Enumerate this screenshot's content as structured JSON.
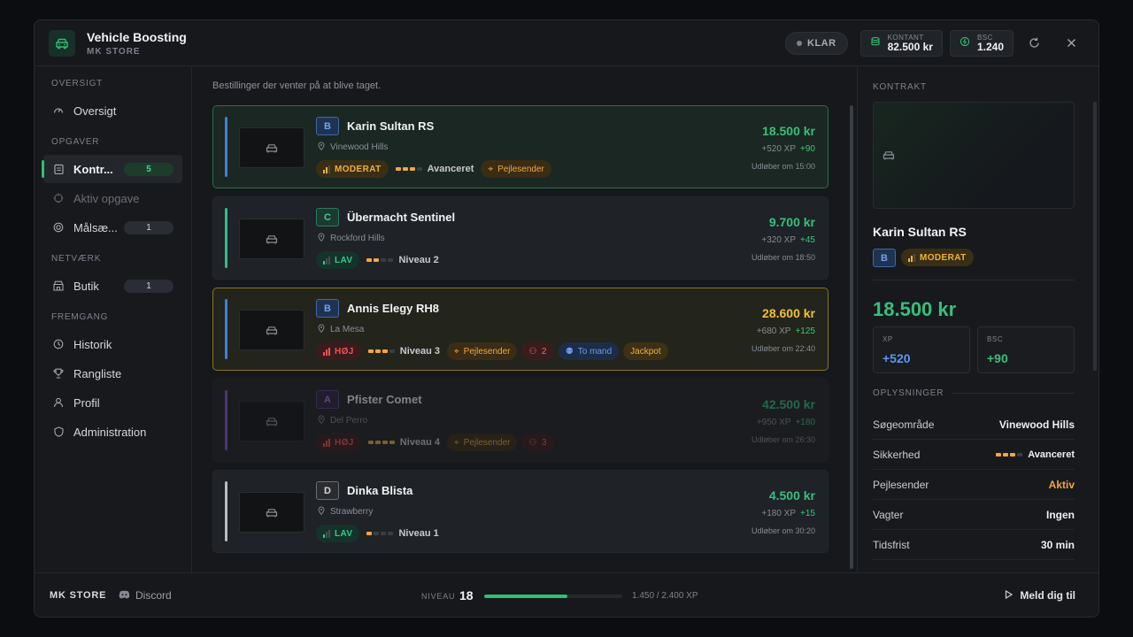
{
  "app": {
    "title": "Vehicle Boosting",
    "subtitle": "MK STORE"
  },
  "header": {
    "status": "KLAR",
    "cash_label": "KONTANT",
    "cash_value": "82.500 kr",
    "bsc_label": "BSC",
    "bsc_value": "1.240",
    "refresh_icon": "refresh-icon",
    "close_icon": "close-icon"
  },
  "sidebar": {
    "sections": [
      {
        "title": "OVERSIGT"
      },
      {
        "title": "OPGAVER"
      },
      {
        "title": "NETVÆRK"
      },
      {
        "title": "FREMGANG"
      }
    ],
    "items": [
      {
        "label": "Oversigt",
        "icon": "gauge-icon"
      },
      {
        "label": "Kontr...",
        "icon": "clipboard-icon",
        "count": "5",
        "active": true
      },
      {
        "label": "Aktiv opgave",
        "icon": "crosshair-icon",
        "disabled": true
      },
      {
        "label": "Målsæ...",
        "icon": "target-icon",
        "count": "1"
      },
      {
        "label": "Butik",
        "icon": "store-icon",
        "count": "1"
      },
      {
        "label": "Historik",
        "icon": "clock-icon"
      },
      {
        "label": "Rangliste",
        "icon": "trophy-icon"
      },
      {
        "label": "Profil",
        "icon": "user-icon"
      },
      {
        "label": "Administration",
        "icon": "shield-icon"
      }
    ]
  },
  "main": {
    "subtitle": "Bestillinger der venter på at blive taget.",
    "contracts": [
      {
        "class": "B",
        "name": "Karin Sultan RS",
        "location": "Vinewood Hills",
        "risk": "MODERAT",
        "security_level": 3,
        "security_label": "Avanceret",
        "tags": [
          "Pejlesender"
        ],
        "price": "18.500 kr",
        "xp": "+520 XP",
        "bsc": "+90",
        "expires": "Udløber om 15:00",
        "accent": "#3f7fe0"
      },
      {
        "class": "C",
        "name": "Übermacht Sentinel",
        "location": "Rockford Hills",
        "risk": "LAV",
        "security_level": 2,
        "security_label": "Niveau 2",
        "tags": [],
        "price": "9.700 kr",
        "xp": "+320 XP",
        "bsc": "+45",
        "expires": "Udløber om 18:50",
        "accent": "#2fbf84"
      },
      {
        "class": "B",
        "name": "Annis Elegy RH8",
        "location": "La Mesa",
        "risk": "HØJ",
        "security_level": 3,
        "security_label": "Niveau 3",
        "tags": [
          "Pejlesender",
          "2",
          "To mand",
          "Jackpot"
        ],
        "price": "28.600 kr",
        "xp": "+680 XP",
        "bsc": "+125",
        "expires": "Udløber om 22:40",
        "accent": "#3f7fe0"
      },
      {
        "class": "A",
        "name": "Pfister Comet",
        "location": "Del Perro",
        "risk": "HØJ",
        "security_level": 4,
        "security_label": "Niveau 4",
        "tags": [
          "Pejlesender",
          "3"
        ],
        "price": "42.500 kr",
        "xp": "+950 XP",
        "bsc": "+180",
        "expires": "Udløber om 26:30",
        "accent": "#8a57d8"
      },
      {
        "class": "D",
        "name": "Dinka Blista",
        "location": "Strawberry",
        "risk": "LAV",
        "security_level": 1,
        "security_label": "Niveau 1",
        "tags": [],
        "price": "4.500 kr",
        "xp": "+180 XP",
        "bsc": "+15",
        "expires": "Udløber om 30:20",
        "accent": "#b9bcc2"
      }
    ]
  },
  "detail": {
    "section_title": "KONTRAKT",
    "name": "Karin Sultan RS",
    "class": "B",
    "risk": "MODERAT",
    "price": "18.500 kr",
    "xp_label": "XP",
    "xp_value": "+520",
    "bsc_label": "BSC",
    "bsc_value": "+90",
    "info_title": "OPLYSNINGER",
    "info": [
      {
        "key": "Søgeområde",
        "value": "Vinewood Hills"
      },
      {
        "key": "Sikkerhed",
        "value": "Avanceret"
      },
      {
        "key": "Pejlesender",
        "value": "Aktiv"
      },
      {
        "key": "Vagter",
        "value": "Ingen"
      },
      {
        "key": "Tidsfrist",
        "value": "30 min"
      }
    ]
  },
  "footer": {
    "brand": "MK STORE",
    "discord": "Discord",
    "level_label": "NIVEAU",
    "level": "18",
    "xp_progress": 0.604,
    "xp_text": "1.450 / 2.400 XP",
    "join": "Meld dig til"
  },
  "colors": {
    "accent": "#2fbf71",
    "gold": "#f2c038",
    "warning": "#f0b13c",
    "danger": "#ec5454"
  }
}
